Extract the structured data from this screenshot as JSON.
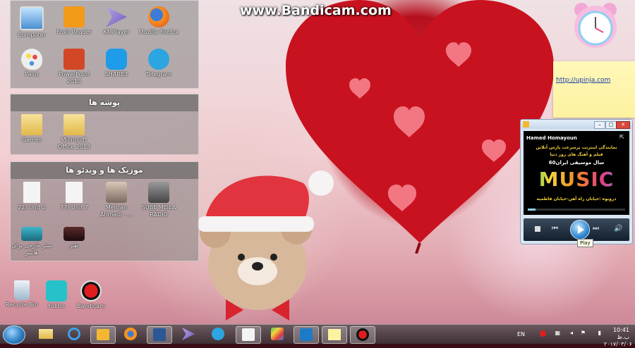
{
  "watermark": "www.Bandicam.com",
  "fences": {
    "apps": {
      "icons": [
        {
          "label": "Computer",
          "icon": "computer-icon"
        },
        {
          "label": "Foxit Reader",
          "icon": "pdf-icon"
        },
        {
          "label": "KMPlayer",
          "icon": "kmplayer-icon"
        },
        {
          "label": "Mozilla Firefox",
          "icon": "firefox-icon"
        },
        {
          "label": "Paint",
          "icon": "paint-icon"
        },
        {
          "label": "PowerPoint 2013",
          "icon": "powerpoint-icon"
        },
        {
          "label": "SHAREit",
          "icon": "shareit-icon"
        },
        {
          "label": "Telegram",
          "icon": "telegram-icon"
        }
      ]
    },
    "folders": {
      "title": "پوشه ها",
      "icons": [
        {
          "label": "Games",
          "icon": "folder-icon"
        },
        {
          "label": "Microsoft Office 2013",
          "icon": "folder-icon"
        }
      ]
    },
    "music": {
      "title": "موزیک ها و ویدئو ها",
      "icons": [
        {
          "label": "22) Unit 2",
          "icon": "mp3-icon"
        },
        {
          "label": "77) Unit 7",
          "icon": "mp3-icon"
        },
        {
          "label": "Mehran Ahmadi - ...",
          "icon": "audio-thumb-icon"
        },
        {
          "label": "SUBE MEILA RADIO",
          "icon": "audio-thumb-icon"
        },
        {
          "label": "سئر خارجی برای هاشر",
          "icon": "video-thumb-icon"
        },
        {
          "label": "طنز",
          "icon": "video-thumb-icon"
        }
      ]
    }
  },
  "desktop_icons": [
    {
      "label": "Recycle Bin",
      "icon": "recycle-bin-icon"
    },
    {
      "label": "Fidibo",
      "icon": "fidibo-icon"
    },
    {
      "label": "Bandicam",
      "icon": "bandicam-icon"
    }
  ],
  "note": {
    "text": "http://upinja.com"
  },
  "media_player": {
    "artist": "Hamed Homayoun",
    "line1": "نمایندگی اینترنت پرسرعت پارس آنلاین",
    "line2": "فیلم و آهنگ های روز دنیا",
    "line3": "60سال موسیقی ایران",
    "music_word": "MUSIC",
    "track": "درویوه :خیابان راه آهن-خیابان فاطمیه",
    "play_tooltip": "Play"
  },
  "tray": {
    "lang": "EN",
    "time": "10:41 ب.ظ",
    "date": "۲۰۱۷/۰۳/۰۶"
  }
}
